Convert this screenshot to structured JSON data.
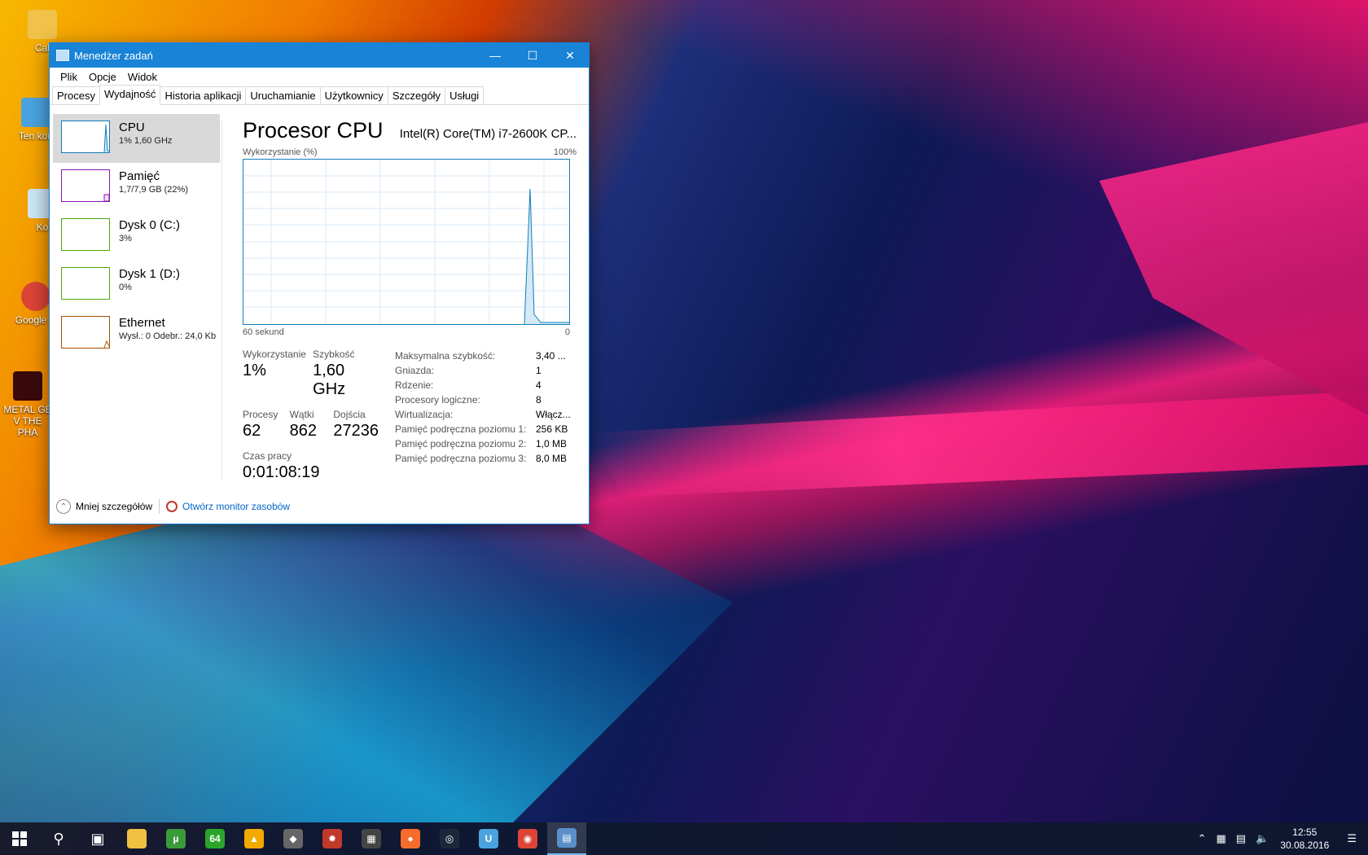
{
  "desktop": {
    "icons": [
      {
        "label": "Cal"
      },
      {
        "label": "Ten kon"
      },
      {
        "label": "Ko"
      },
      {
        "label": "Google C"
      },
      {
        "label": "METAL GE V THE PHA"
      }
    ]
  },
  "window": {
    "title": "Menedżer zadań",
    "menu": [
      "Plik",
      "Opcje",
      "Widok"
    ],
    "tabs": [
      "Procesy",
      "Wydajność",
      "Historia aplikacji",
      "Uruchamianie",
      "Użytkownicy",
      "Szczegóły",
      "Usługi"
    ],
    "active_tab": "Wydajność",
    "resources": [
      {
        "name": "CPU",
        "value": "1% 1,60 GHz",
        "color": "#117dbb"
      },
      {
        "name": "Pamięć",
        "value": "1,7/7,9 GB (22%)",
        "color": "#8b12ae"
      },
      {
        "name": "Dysk 0 (C:)",
        "value": "3%",
        "color": "#4da60c"
      },
      {
        "name": "Dysk 1 (D:)",
        "value": "0%",
        "color": "#4da60c"
      },
      {
        "name": "Ethernet",
        "value": "Wysł.: 0 Odebr.: 24,0 Kb",
        "color": "#a74f01"
      }
    ],
    "cpu": {
      "heading": "Procesor CPU",
      "model": "Intel(R) Core(TM) i7-2600K CP...",
      "graph_label": "Wykorzystanie (%)",
      "graph_max": "100%",
      "graph_time": "60 sekund",
      "graph_min": "0",
      "stats": {
        "usage_label": "Wykorzystanie",
        "usage": "1%",
        "speed_label": "Szybkość",
        "speed": "1,60 GHz",
        "processes_label": "Procesy",
        "processes": "62",
        "threads_label": "Wątki",
        "threads": "862",
        "handles_label": "Dojścia",
        "handles": "27236",
        "uptime_label": "Czas pracy",
        "uptime": "0:01:08:19"
      },
      "details": [
        {
          "k": "Maksymalna szybkość:",
          "v": "3,40 ..."
        },
        {
          "k": "Gniazda:",
          "v": "1"
        },
        {
          "k": "Rdzenie:",
          "v": "4"
        },
        {
          "k": "Procesory logiczne:",
          "v": "8"
        },
        {
          "k": "Wirtualizacja:",
          "v": "Włącz..."
        },
        {
          "k": "Pamięć podręczna poziomu 1:",
          "v": "256 KB"
        },
        {
          "k": "Pamięć podręczna poziomu 2:",
          "v": "1,0 MB"
        },
        {
          "k": "Pamięć podręczna poziomu 3:",
          "v": "8,0 MB"
        }
      ]
    },
    "footer": {
      "less_details": "Mniej szczegółów",
      "open_monitor": "Otwórz monitor zasobów"
    }
  },
  "taskbar": {
    "apps": [
      {
        "name": "file-explorer-icon",
        "glyph": "",
        "color": "#f0c040"
      },
      {
        "name": "utorrent-icon",
        "glyph": "µ",
        "color": "#3a9a3a"
      },
      {
        "name": "aida64-icon",
        "glyph": "64",
        "color": "#2aa52a"
      },
      {
        "name": "origin-triangle-icon",
        "glyph": "▲",
        "color": "#f2a900"
      },
      {
        "name": "warning-icon",
        "glyph": "◆",
        "color": "#666666"
      },
      {
        "name": "aida-icon",
        "glyph": "✹",
        "color": "#c0392b"
      },
      {
        "name": "clapper-icon",
        "glyph": "▦",
        "color": "#444444"
      },
      {
        "name": "origin-icon",
        "glyph": "●",
        "color": "#f56c2d"
      },
      {
        "name": "steam-icon",
        "glyph": "◎",
        "color": "#1b2838"
      },
      {
        "name": "uplay-icon",
        "glyph": "U",
        "color": "#4aa3df"
      },
      {
        "name": "chrome-icon",
        "glyph": "◉",
        "color": "#db4437"
      },
      {
        "name": "task-manager-icon",
        "glyph": "▤",
        "color": "#5a8fc8"
      }
    ],
    "time": "12:55",
    "date": "30.08.2016"
  }
}
